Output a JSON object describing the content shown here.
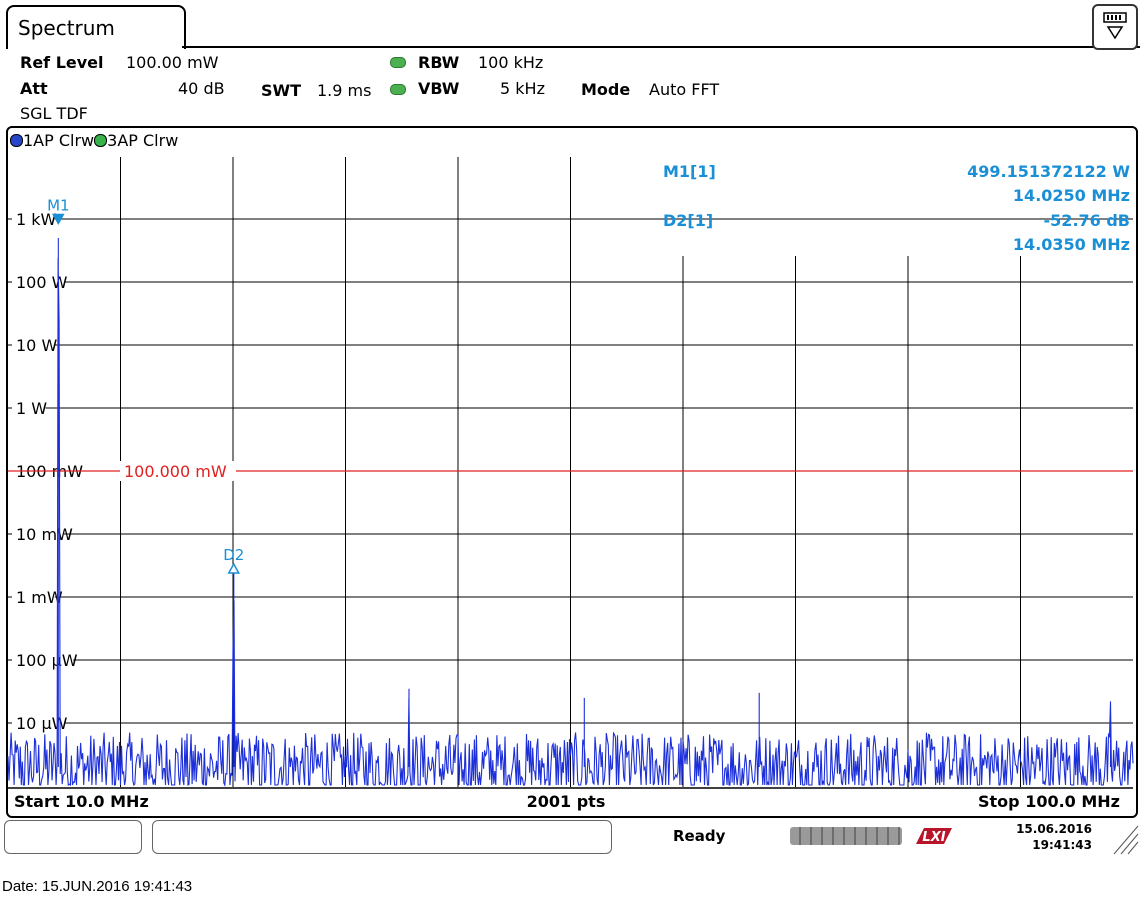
{
  "window": {
    "tab_title": "Spectrum",
    "settings_icon": "display-config-icon"
  },
  "settings": {
    "ref_level_label": "Ref Level",
    "ref_level_value": "100.00 mW",
    "att_label": "Att",
    "att_value": "40 dB",
    "swt_label": "SWT",
    "swt_value": "1.9 ms",
    "rbw_label": "RBW",
    "rbw_value": "100 kHz",
    "vbw_label": "VBW",
    "vbw_value": "5 kHz",
    "mode_label": "Mode",
    "mode_value": "Auto FFT",
    "sweep_flags": "SGL TDF",
    "coupled_indicator_color": "#4caf50"
  },
  "traces": {
    "trace1": {
      "label": "1AP Clrw",
      "color": "#2747c9"
    },
    "trace3": {
      "label": "3AP Clrw",
      "color": "#37b34a"
    }
  },
  "markers": {
    "m1_label": "M1[1]",
    "m1_level": "499.151372122 W",
    "m1_freq": "14.0250 MHz",
    "d2_label": "D2[1]",
    "d2_level": "-52.76 dB",
    "d2_freq": "14.0350 MHz",
    "m1_plot_label": "M1",
    "d2_plot_label": "D2",
    "color": "#1a8fd6"
  },
  "threshold": {
    "label": "100.000 mW",
    "color": "#e02020"
  },
  "axis": {
    "start_label": "Start 10.0 MHz",
    "points_label": "2001 pts",
    "stop_label": "Stop 100.0 MHz"
  },
  "chart_data": {
    "type": "line",
    "x_unit": "MHz",
    "y_scale": "log",
    "xlim": [
      10.0,
      100.0
    ],
    "ylim_labels": [
      "1 kW",
      "100 W",
      "10 W",
      "1 W",
      "100 mW",
      "10 mW",
      "1 mW",
      "100 µW",
      "10 µW"
    ],
    "y_ticks_w": [
      1000,
      100,
      10,
      1,
      0.1,
      0.01,
      0.001,
      0.0001,
      1e-05
    ],
    "grid": true,
    "series": [
      {
        "name": "1AP Clrw",
        "noise_floor_w": 2e-06,
        "peaks": [
          {
            "x": 14.025,
            "y": 499.15
          },
          {
            "x": 28.06,
            "y": 0.0024
          },
          {
            "x": 42.08,
            "y": 3.5e-05
          },
          {
            "x": 56.1,
            "y": 2.5e-05
          },
          {
            "x": 70.1,
            "y": 3e-05
          },
          {
            "x": 98.2,
            "y": 2.2e-05
          }
        ]
      }
    ],
    "threshold_w": 0.1
  },
  "status": {
    "ready": "Ready",
    "date": "15.06.2016",
    "time": "19:41:43",
    "lxi_logo": "LXI"
  },
  "footer": {
    "date_line": "Date: 15.JUN.2016  19:41:43"
  }
}
